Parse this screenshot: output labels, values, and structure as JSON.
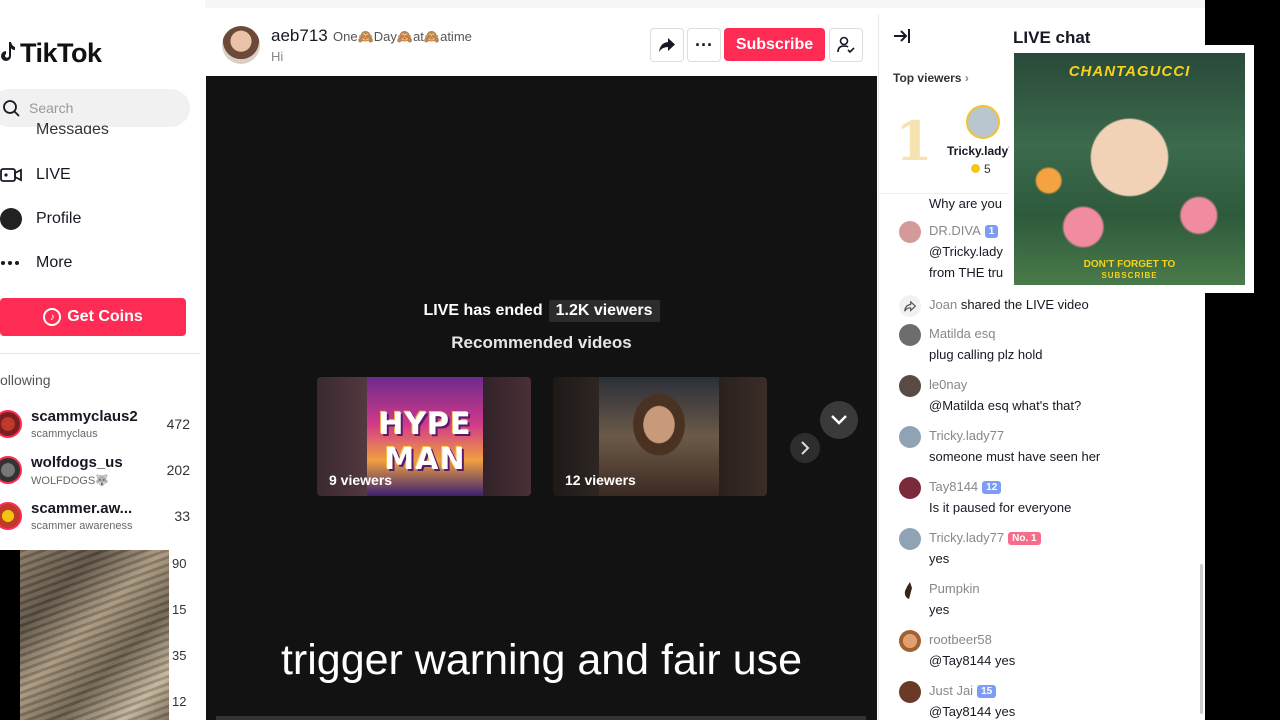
{
  "app": {
    "logo": "TikTok"
  },
  "sidebar": {
    "search_placeholder": "Search",
    "cut_item": "Messages",
    "nav": [
      {
        "label": "LIVE",
        "icon": "live-camera-icon"
      },
      {
        "label": "Profile",
        "icon": "profile-avatar-icon"
      },
      {
        "label": "More",
        "icon": "more-dots-icon"
      }
    ],
    "get_coins": "Get Coins",
    "following_title": "ollowing",
    "following": [
      {
        "name": "scammyclaus2",
        "sub": "scammyclaus",
        "count": "472"
      },
      {
        "name": "wolfdogs_us",
        "sub": "WOLFDOGS🐺",
        "count": "202"
      },
      {
        "name": "scammer.aw...",
        "sub": "scammer awareness",
        "count": "33"
      }
    ],
    "extra_counts": [
      "90",
      "15",
      "35",
      "12"
    ]
  },
  "host": {
    "name": "aeb713",
    "title": "One🙈Day🙈at🙈atime",
    "description": "Hi",
    "subscribe_label": "Subscribe",
    "more_label": "···"
  },
  "video": {
    "ended_text": "LIVE has ended",
    "viewers": "1.2K viewers",
    "recommended": "Recommended videos",
    "cards": [
      {
        "viewers": "9 viewers",
        "thumb_text": "HYPE MAN"
      },
      {
        "viewers": "12 viewers"
      }
    ],
    "subtitle": "trigger warning and fair use"
  },
  "chat": {
    "title": "LIVE chat",
    "top_viewers": "Top viewers",
    "top_rank": "1",
    "top_name": "Tricky.lady77",
    "top_coins": "5",
    "partial_text": "Why are you",
    "messages": [
      {
        "name": "DR.DIVA",
        "badge": "1",
        "badge_color": "blue",
        "lines": [
          "@Tricky.lady",
          "from THE tru"
        ]
      },
      {
        "system": true,
        "name": "Joan",
        "text": "shared the LIVE video"
      },
      {
        "name": "Matilda esq",
        "text": "plug calling plz hold"
      },
      {
        "name": "le0nay",
        "text": "@Matilda esq what's that?"
      },
      {
        "name": "Tricky.lady77",
        "text": "someone must have seen her"
      },
      {
        "name": "Tay8144",
        "badge": "12",
        "badge_color": "blue",
        "text": "Is it paused for everyone"
      },
      {
        "name": "Tricky.lady77",
        "badge": "No. 1",
        "badge_color": "pink",
        "text": "yes"
      },
      {
        "name": "Pumpkin",
        "text": "yes"
      },
      {
        "name": "rootbeer58",
        "text": "@Tay8144 yes"
      },
      {
        "name": "Just Jai",
        "badge": "15",
        "badge_color": "blue",
        "text": "@Tay8144 yes"
      }
    ]
  },
  "promo": {
    "top_text": "CHANTAGUCCI",
    "bottom_line1": "DON'T FORGET TO",
    "bottom_line2": "SUBSCRIBE"
  },
  "colors": {
    "brand": "#fe2c55",
    "badge_blue": "#7c9cf5",
    "badge_pink": "#f56d8a"
  }
}
